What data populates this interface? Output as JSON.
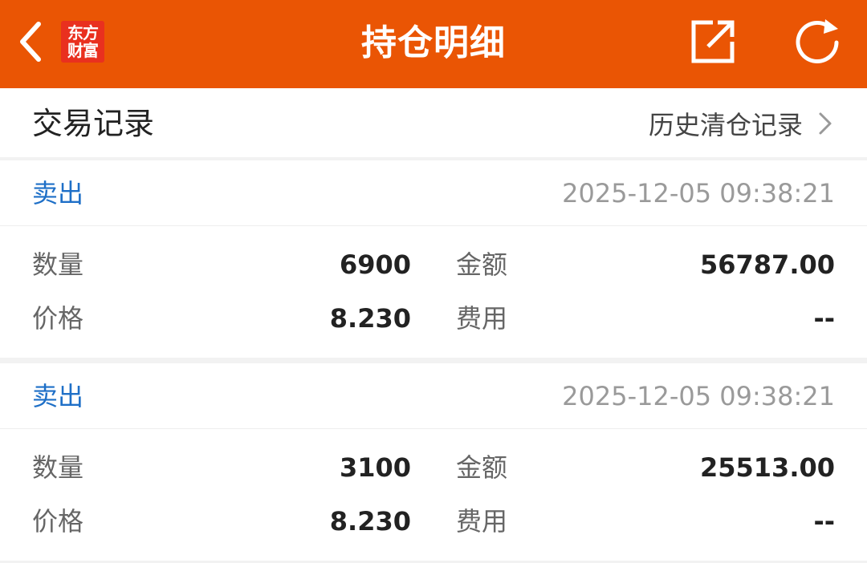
{
  "header": {
    "title": "持仓明细",
    "logo_line1": "东方",
    "logo_line2": "财富",
    "icons": [
      "chevron-left-icon",
      "share-icon",
      "refresh-icon"
    ],
    "bg_color": "#ea5504",
    "logo_color": "#e9301f"
  },
  "section": {
    "title": "交易记录",
    "history_link": "历史清仓记录"
  },
  "records": [
    {
      "type": "卖出",
      "time": "2025-12-05 09:38:21",
      "quantity_label": "数量",
      "quantity": "6900",
      "amount_label": "金额",
      "amount": "56787.00",
      "price_label": "价格",
      "price": "8.230",
      "fee_label": "费用",
      "fee": "--"
    },
    {
      "type": "卖出",
      "time": "2025-12-05 09:38:21",
      "quantity_label": "数量",
      "quantity": "3100",
      "amount_label": "金额",
      "amount": "25513.00",
      "price_label": "价格",
      "price": "8.230",
      "fee_label": "费用",
      "fee": "--"
    }
  ],
  "colors": {
    "sell_type": "#1e6fc7",
    "timestamp": "#9a9a9a",
    "label": "#666666"
  }
}
